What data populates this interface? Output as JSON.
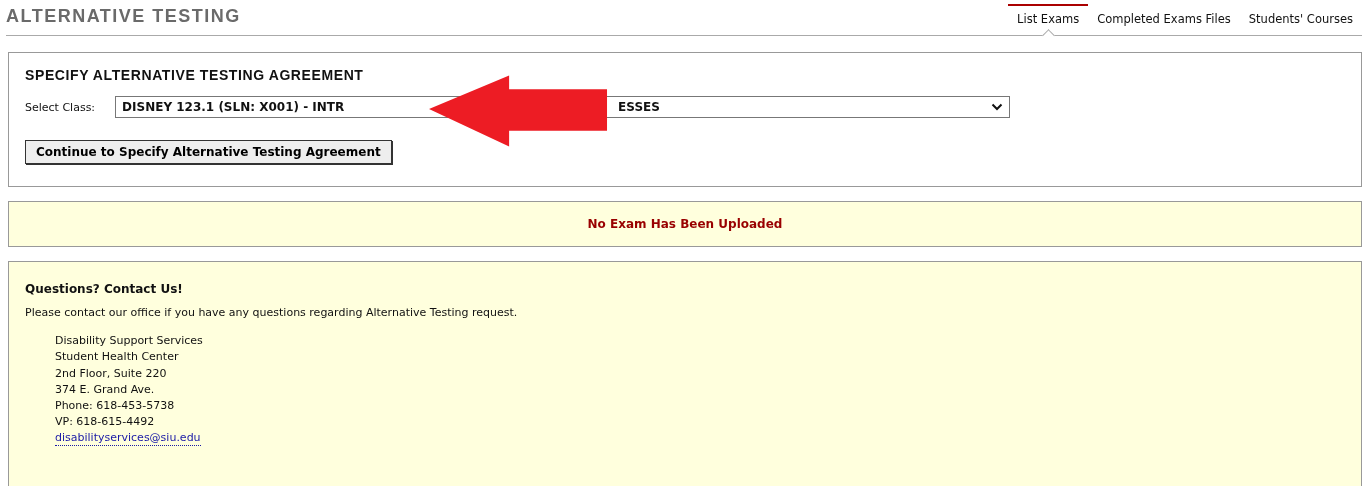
{
  "page_title": "ALTERNATIVE TESTING",
  "tabs": [
    {
      "label": "List Exams",
      "selected": true
    },
    {
      "label": "Completed Exams Files",
      "selected": false
    },
    {
      "label": "Students' Courses",
      "selected": false
    }
  ],
  "agreement": {
    "heading": "SPECIFY ALTERNATIVE TESTING AGREEMENT",
    "select_label": "Select Class:",
    "select_value_start": "DISNEY 123.1 (SLN: X001) - INTR",
    "select_value_end": "ESSES",
    "button": "Continue to Specify Alternative Testing Agreement"
  },
  "notice": "No Exam Has Been Uploaded",
  "contact": {
    "heading": "Questions? Contact Us!",
    "intro": "Please contact our office if you have any questions regarding Alternative Testing request.",
    "address_lines": [
      "Disability Support Services",
      "Student Health Center",
      "2nd Floor, Suite 220",
      "374 E. Grand Ave.",
      "Phone: 618-453-5738",
      "VP: 618-615-4492"
    ],
    "email": "disabilityservices@siu.edu"
  }
}
